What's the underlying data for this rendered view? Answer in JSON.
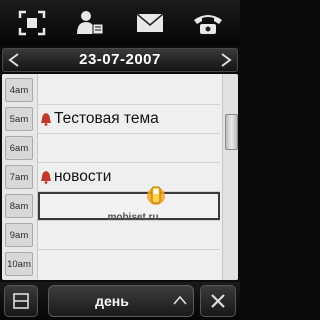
{
  "toolbar": {
    "icons": [
      "focus-frame-icon",
      "contacts-icon",
      "envelope-icon",
      "phone-icon"
    ]
  },
  "date_nav": {
    "date": "23-07-2007"
  },
  "hours": [
    "4am",
    "5am",
    "6am",
    "7am",
    "8am",
    "9am",
    "10am"
  ],
  "events": [
    {
      "hour": "5am",
      "title": "Тестовая тема",
      "alarm": true
    },
    {
      "hour": "7am",
      "title": "новости",
      "alarm": true
    }
  ],
  "selected_hour": "8am",
  "watermark": "mobiset.ru",
  "bottom_bar": {
    "view_label": "день"
  },
  "colors": {
    "background": "#0b0b0b",
    "calendar_bg": "#efefef",
    "bell": "#c0392b",
    "text_dark": "#141414"
  }
}
